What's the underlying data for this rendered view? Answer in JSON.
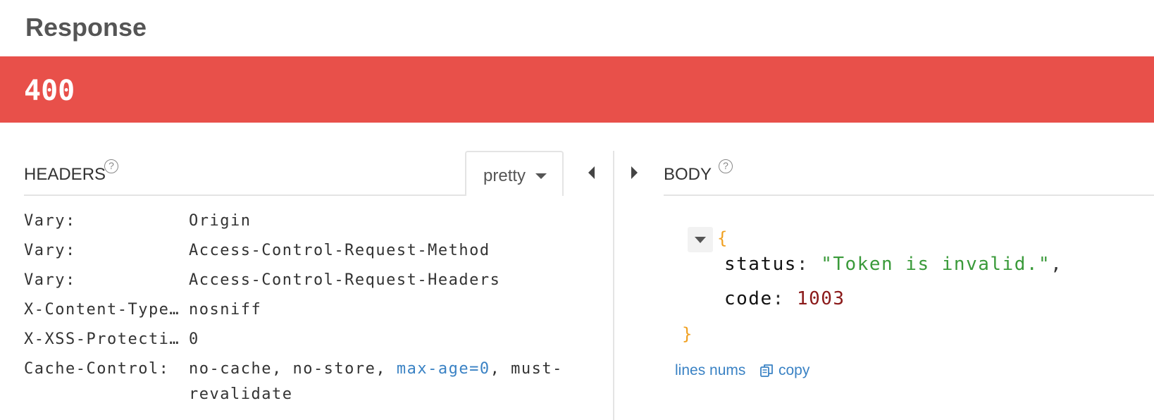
{
  "response": {
    "title": "Response",
    "status_code": "400",
    "status_color": "#e8504a"
  },
  "headers": {
    "label": "HEADERS",
    "help": "?",
    "format_select": "pretty",
    "rows": [
      {
        "key": "Vary:",
        "value": "Origin"
      },
      {
        "key": "Vary:",
        "value": "Access-Control-Request-Method"
      },
      {
        "key": "Vary:",
        "value": "Access-Control-Request-Headers"
      },
      {
        "key": "X-Content-Type…",
        "value": "nosniff"
      },
      {
        "key": "X-XSS-Protecti…",
        "value": "0"
      },
      {
        "key": "Cache-Control:",
        "value_parts": [
          "no-cache, no-store, ",
          "max-age=0",
          ", must-"
        ],
        "value_cont": "revalidate"
      }
    ]
  },
  "body": {
    "label": "BODY",
    "help": "?",
    "open_brace": "{",
    "close_brace": "}",
    "fields": [
      {
        "key": "status",
        "value": "\"Token is invalid.\"",
        "trailing": ","
      },
      {
        "key": "code",
        "value": "1003",
        "trailing": ""
      }
    ],
    "lines_nums_label": "lines nums",
    "copy_label": "copy"
  },
  "icons": {
    "collapse_left": "caret-left-icon",
    "expand_right": "caret-right-icon",
    "toggle": "caret-down-icon",
    "copy": "copy-icon",
    "help": "question-circle-icon"
  }
}
